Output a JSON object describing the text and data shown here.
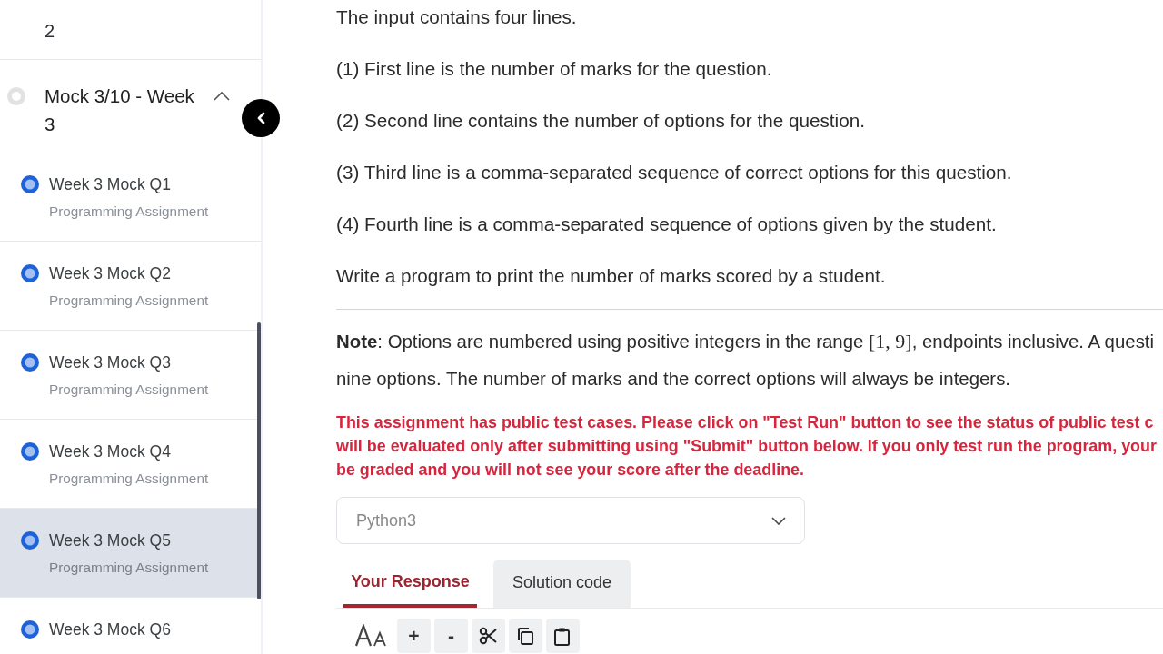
{
  "sidebar": {
    "partial_title": "2",
    "section": {
      "title": "Mock 3/10 - Week 3",
      "expanded": true,
      "items": [
        {
          "title": "Week 3 Mock Q1",
          "subtitle": "Programming Assignment",
          "selected": false
        },
        {
          "title": "Week 3 Mock Q2",
          "subtitle": "Programming Assignment",
          "selected": false
        },
        {
          "title": "Week 3 Mock Q3",
          "subtitle": "Programming Assignment",
          "selected": false
        },
        {
          "title": "Week 3 Mock Q4",
          "subtitle": "Programming Assignment",
          "selected": false
        },
        {
          "title": "Week 3 Mock Q5",
          "subtitle": "Programming Assignment",
          "selected": true
        },
        {
          "title": "Week 3 Mock Q6",
          "selected": false
        }
      ]
    }
  },
  "problem": {
    "paragraphs": [
      "The input contains four lines.",
      "(1) First line is the number of marks for the question.",
      "(2) Second line contains the number of options for the question.",
      "(3) Third line is a comma-separated sequence of correct options for this question.",
      "(4) Fourth line is a comma-separated sequence of options given by the student.",
      "Write a program to print the number of marks scored by a student."
    ],
    "note_lines": [
      [
        {
          "kind": "bold",
          "text": "Note"
        },
        {
          "kind": "text",
          "text": ": Options are numbered using positive integers in the range "
        },
        {
          "kind": "math",
          "text": "[1, 9]"
        },
        {
          "kind": "text",
          "text": ", endpoints inclusive. A questi"
        }
      ],
      [
        {
          "kind": "text",
          "text": "nine options. The number of marks and the correct options will always be integers."
        }
      ]
    ],
    "warning_lines": [
      "This assignment has public test cases. Please click on \"Test Run\" button to see the status of public test c",
      "will be evaluated only after submitting using \"Submit\" button below. If you only test run the program, your",
      "be graded and you will not see your score after the deadline."
    ]
  },
  "editor": {
    "language_select": {
      "value": "Python3"
    },
    "tabs": [
      {
        "label": "Your Response",
        "selected": true
      },
      {
        "label": "Solution code",
        "selected": false
      }
    ],
    "toolbar": [
      {
        "kind": "font-size"
      },
      {
        "kind": "plus",
        "label": "+"
      },
      {
        "kind": "minus",
        "label": "-"
      },
      {
        "kind": "cut"
      },
      {
        "kind": "copy"
      },
      {
        "kind": "paste"
      }
    ]
  }
}
